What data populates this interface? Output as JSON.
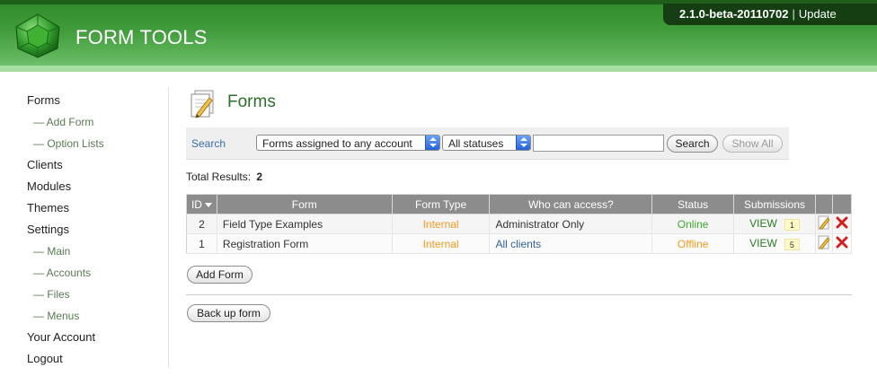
{
  "header": {
    "app_title": "FORM TOOLS",
    "version": "2.1.0-beta-20110702",
    "separator": "|",
    "update_link": "Update",
    "colors": {
      "header_green": "#3f9a3a",
      "version_box": "#153f13"
    }
  },
  "sidebar": {
    "items": [
      {
        "label": "Forms"
      },
      {
        "label": "— Add Form"
      },
      {
        "label": "— Option Lists"
      },
      {
        "label": "Clients"
      },
      {
        "label": "Modules"
      },
      {
        "label": "Themes"
      },
      {
        "label": "Settings"
      },
      {
        "label": "— Main"
      },
      {
        "label": "— Accounts"
      },
      {
        "label": "— Files"
      },
      {
        "label": "— Menus"
      },
      {
        "label": "Your Account"
      },
      {
        "label": "Logout"
      }
    ]
  },
  "page": {
    "title": "Forms",
    "icon": "forms-page-icon"
  },
  "search": {
    "label": "Search",
    "account_filter": "Forms assigned to any account",
    "status_filter": "All statuses",
    "query_value": "",
    "search_button": "Search",
    "show_all_button": "Show All"
  },
  "results": {
    "label": "Total Results:",
    "count": "2"
  },
  "table": {
    "headers": [
      "ID",
      "Form",
      "Form Type",
      "Who can access?",
      "Status",
      "Submissions"
    ],
    "rows": [
      {
        "id": "2",
        "form": "Field Type Examples",
        "type": "Internal",
        "access": "Administrator Only",
        "status": "Online",
        "view": "VIEW",
        "count": "1"
      },
      {
        "id": "1",
        "form": "Registration Form",
        "type": "Internal",
        "access": "All clients",
        "status": "Offline",
        "view": "VIEW",
        "count": "5"
      }
    ]
  },
  "buttons": {
    "add_form": "Add Form",
    "backup_form": "Back up form"
  }
}
